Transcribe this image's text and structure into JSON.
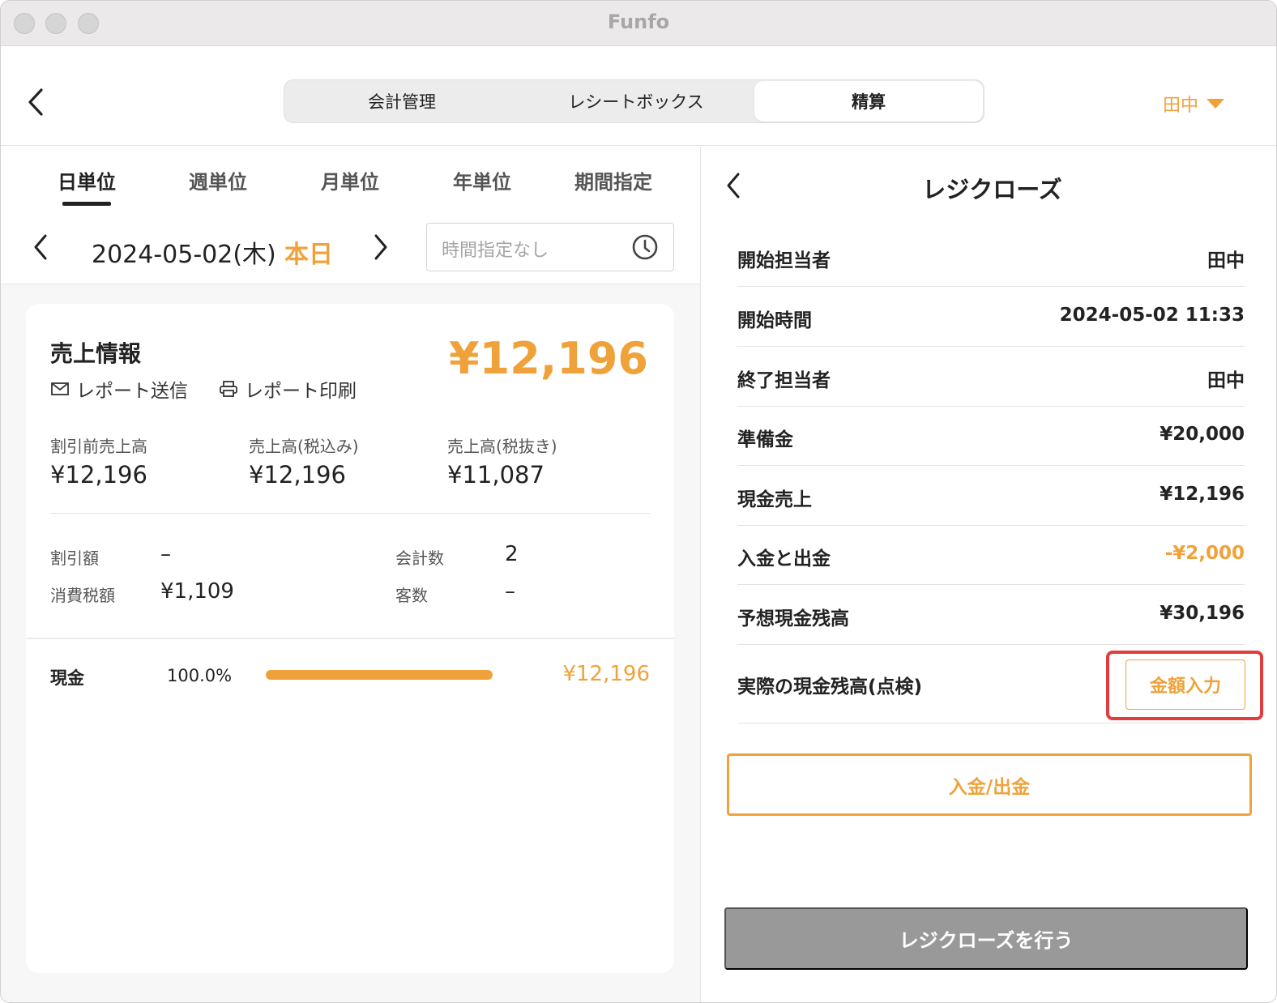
{
  "window": {
    "title": "Funfo"
  },
  "header": {
    "tabs": [
      {
        "label": "会計管理"
      },
      {
        "label": "レシートボックス"
      },
      {
        "label": "精算"
      }
    ],
    "user": "田中"
  },
  "left": {
    "period_tabs": [
      {
        "label": "日単位"
      },
      {
        "label": "週単位"
      },
      {
        "label": "月単位"
      },
      {
        "label": "年単位"
      },
      {
        "label": "期間指定"
      }
    ],
    "date": "2024-05-02(木)",
    "today_label": "本日",
    "time_placeholder": "時間指定なし",
    "sales": {
      "title": "売上情報",
      "total": "¥12,196",
      "send_report": "レポート送信",
      "print_report": "レポート印刷",
      "stats": [
        {
          "label": "割引前売上高",
          "value": "¥12,196"
        },
        {
          "label": "売上高(税込み)",
          "value": "¥12,196"
        },
        {
          "label": "売上高(税抜き)",
          "value": "¥11,087"
        }
      ],
      "details": {
        "discount_label": "割引額",
        "discount_value": "–",
        "tax_label": "消費税額",
        "tax_value": "¥1,109",
        "count_label": "会計数",
        "count_value": "2",
        "customers_label": "客数",
        "customers_value": "–"
      },
      "payment": {
        "label": "現金",
        "percent": "100.0%",
        "fraction": 1.0,
        "amount": "¥12,196"
      }
    }
  },
  "right": {
    "title": "レジクローズ",
    "rows": [
      {
        "label": "開始担当者",
        "value": "田中"
      },
      {
        "label": "開始時間",
        "value": "2024-05-02 11:33"
      },
      {
        "label": "終了担当者",
        "value": "田中"
      },
      {
        "label": "準備金",
        "value": "¥20,000"
      },
      {
        "label": "現金売上",
        "value": "¥12,196"
      },
      {
        "label": "入金と出金",
        "value": "-¥2,000"
      },
      {
        "label": "予想現金残高",
        "value": "¥30,196"
      }
    ],
    "actual_label": "実際の現金残高(点検)",
    "amount_input_button": "金額入力",
    "inout_button": "入金/出金",
    "close_button": "レジクローズを行う"
  },
  "colors": {
    "accent": "#f0a23a",
    "highlight": "#e23c3c",
    "disabled": "#999999"
  }
}
